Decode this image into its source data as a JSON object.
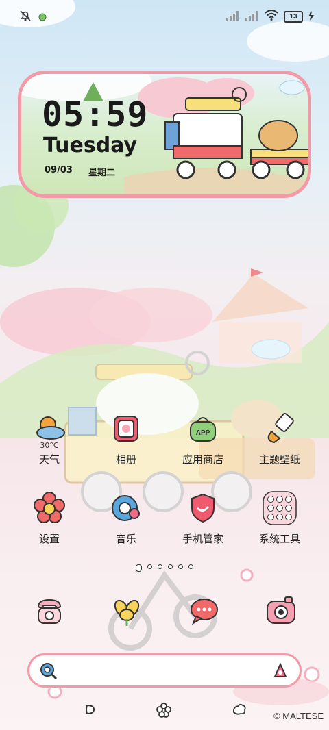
{
  "status_bar": {
    "battery": "13",
    "icons": [
      "bell-off-icon",
      "notification-dot-icon",
      "signal-sim1-icon",
      "signal-sim2-icon",
      "wifi-icon",
      "battery-icon",
      "charging-icon"
    ]
  },
  "clock_widget": {
    "time": "05:59",
    "day": "Tuesday",
    "date": "09/03",
    "weekday": "星期二"
  },
  "apps_row1": [
    {
      "label": "天气",
      "sub": "30°C",
      "icon": "weather-icon"
    },
    {
      "label": "相册",
      "icon": "gallery-icon"
    },
    {
      "label": "应用商店",
      "icon": "app-store-icon"
    },
    {
      "label": "主题壁纸",
      "icon": "theme-brush-icon"
    }
  ],
  "apps_row2": [
    {
      "label": "设置",
      "icon": "settings-flower-icon"
    },
    {
      "label": "音乐",
      "icon": "music-icon"
    },
    {
      "label": "手机管家",
      "icon": "security-shield-icon"
    },
    {
      "label": "系统工具",
      "icon": "tools-folder-icon"
    }
  ],
  "page_dots": {
    "count": 6,
    "active": 0
  },
  "dock": [
    "phone-icon",
    "browser-flower-icon",
    "messages-icon",
    "camera-icon"
  ],
  "search": {
    "placeholder": ""
  },
  "nav": [
    "back-icon",
    "home-icon",
    "recents-icon"
  ],
  "copyright": "© MALTESE",
  "colors": {
    "accent": "#f29aa8",
    "text": "#1a1a1a"
  }
}
